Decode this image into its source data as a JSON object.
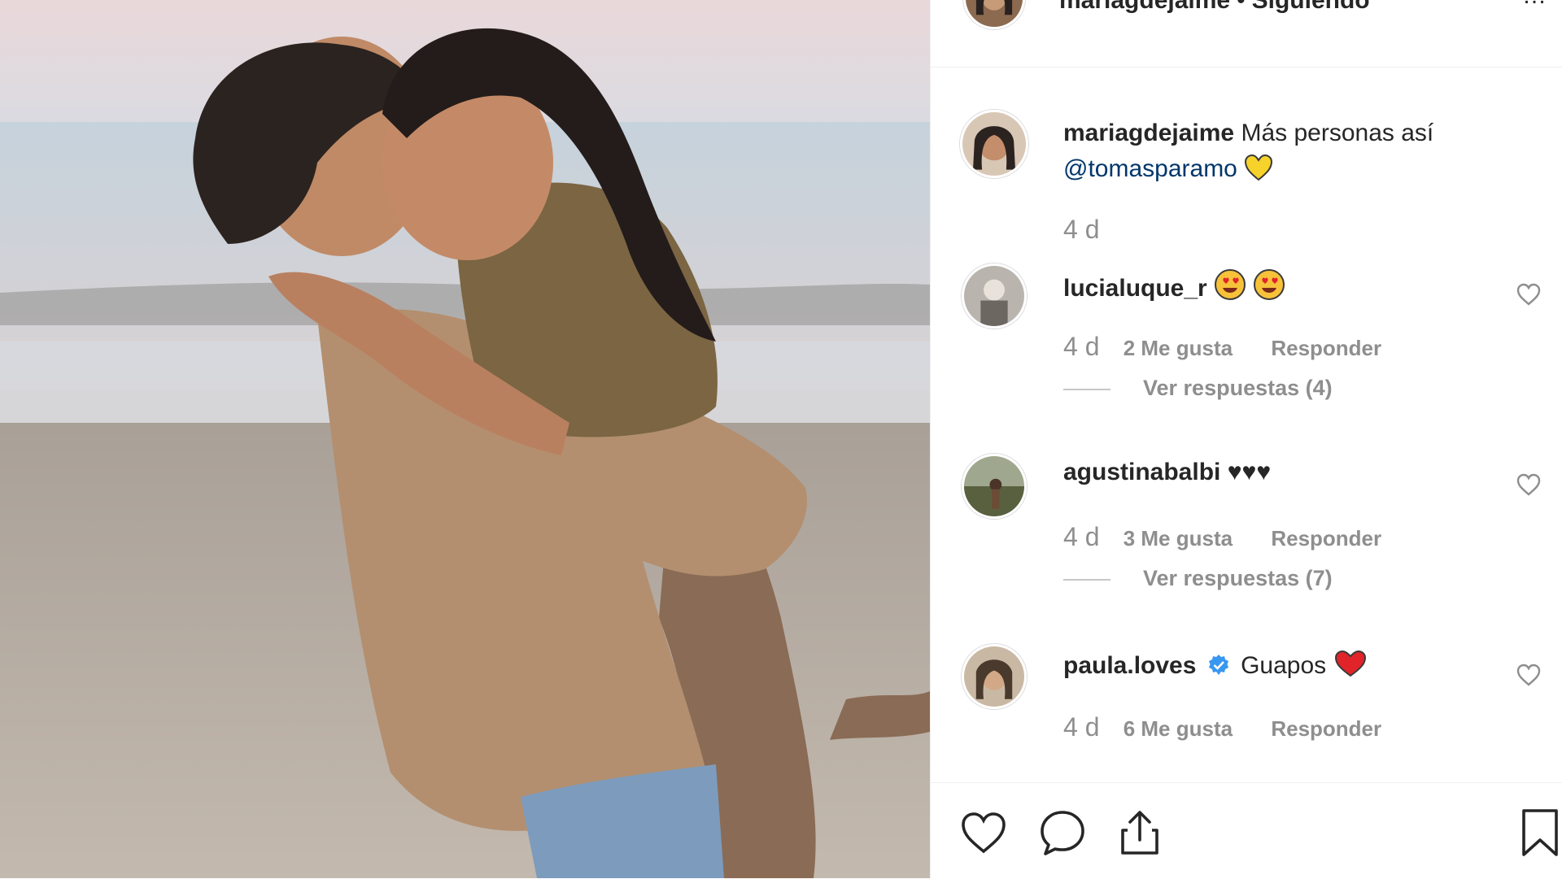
{
  "header": {
    "author": "mariagdejaime",
    "separator": "•",
    "follow_status": "Siguiendo",
    "more": "…"
  },
  "caption": {
    "username": "mariagdejaime",
    "text": "Más personas así",
    "mention": "@tomasparamo",
    "emoji": "yellow-heart",
    "time": "4 d"
  },
  "comments": [
    {
      "username": "lucialuque_r",
      "text": "",
      "emoji": "heart-eyes-face x2",
      "time": "4 d",
      "likes": "2 Me gusta",
      "reply": "Responder",
      "replies": "Ver respuestas (4)"
    },
    {
      "username": "agustinabalbi",
      "text": "♥♥♥",
      "time": "4 d",
      "likes": "3 Me gusta",
      "reply": "Responder",
      "replies": "Ver respuestas (7)"
    },
    {
      "username": "paula.loves",
      "verified": true,
      "text": "Guapos",
      "emoji": "red-heart",
      "time": "4 d",
      "likes": "6 Me gusta",
      "reply": "Responder"
    }
  ],
  "actions": {
    "like": "heart-icon",
    "comment": "comment-bubble-icon",
    "share": "share-icon",
    "save": "bookmark-icon"
  },
  "colors": {
    "text": "#262626",
    "muted": "#8e8e8e",
    "mention": "#00376b",
    "verified": "#3897f0",
    "border": "#efefef"
  }
}
